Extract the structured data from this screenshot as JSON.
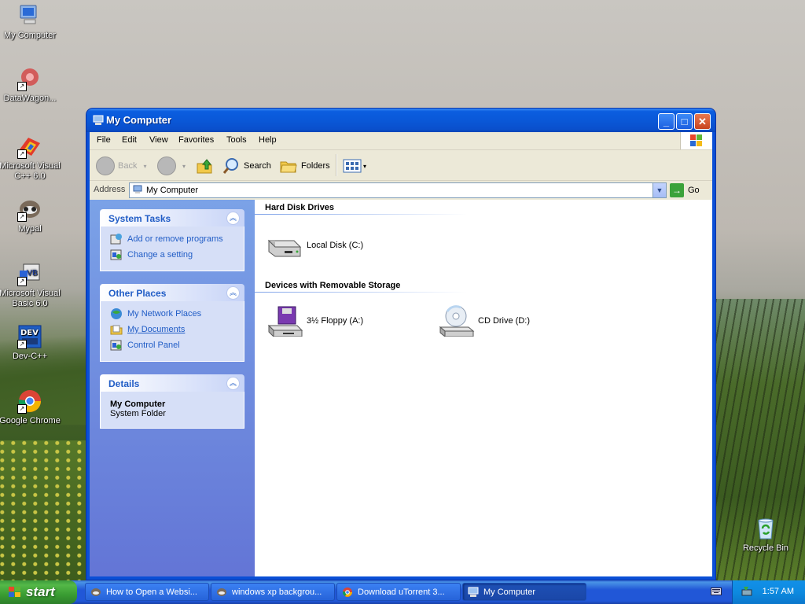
{
  "desktop": {
    "icons": [
      {
        "label": "My Computer"
      },
      {
        "label": "DataWagon..."
      },
      {
        "label": "Microsoft Visual C++ 6.0"
      },
      {
        "label": "Mypal"
      },
      {
        "label": "Microsoft Visual Basic 6.0"
      },
      {
        "label": "Dev-C++"
      },
      {
        "label": "Google Chrome"
      },
      {
        "label": "Recycle Bin"
      }
    ]
  },
  "window": {
    "title": "My Computer",
    "buttons": {
      "minimize": "_",
      "maximize": "□",
      "close": "✕"
    }
  },
  "menu": [
    "File",
    "Edit",
    "View",
    "Favorites",
    "Tools",
    "Help"
  ],
  "toolbar": {
    "back": "Back",
    "search": "Search",
    "folders": "Folders"
  },
  "address": {
    "label": "Address",
    "value": "My Computer",
    "go": "Go"
  },
  "taskpane": {
    "system_tasks": {
      "title": "System Tasks",
      "links": [
        "Add or remove programs",
        "Change a setting"
      ]
    },
    "other_places": {
      "title": "Other Places",
      "links": [
        "My Network Places",
        "My Documents",
        "Control Panel"
      ]
    },
    "details": {
      "title": "Details",
      "name": "My Computer",
      "type": "System Folder"
    }
  },
  "content": {
    "groups": [
      {
        "title": "Hard Disk Drives",
        "items": [
          "Local Disk (C:)"
        ]
      },
      {
        "title": "Devices with Removable Storage",
        "items": [
          "3½ Floppy (A:)",
          "CD Drive (D:)"
        ]
      }
    ]
  },
  "taskbar": {
    "start": "start",
    "tasks": [
      "How to Open a Websi...",
      "windows xp backgrou...",
      "Download uTorrent 3...",
      "My Computer"
    ],
    "clock": "1:57 AM"
  },
  "colors": {
    "xp_blue": "#0a58d8",
    "taskpane_link": "#215dc6",
    "start_green": "#3a9d32"
  }
}
